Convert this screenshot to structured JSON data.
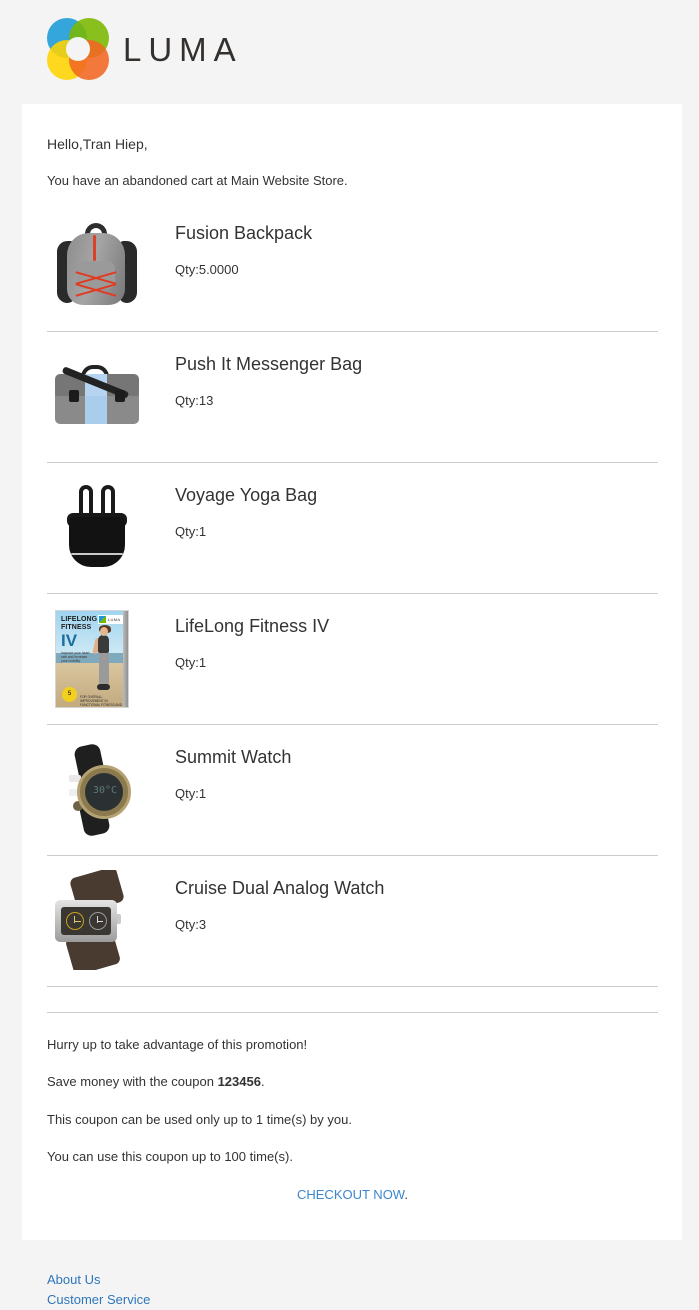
{
  "brand": {
    "name": "LUMA",
    "logo_colors": {
      "blue": "#1a9bd7",
      "green": "#7ab800",
      "yellow": "#ffd400",
      "orange": "#f26722"
    }
  },
  "body": {
    "greeting": "Hello,Tran Hiep,",
    "intro": "You have an abandoned cart at Main Website Store."
  },
  "products": [
    {
      "name": "Fusion Backpack",
      "qty_label": "Qty:5.0000",
      "image": "backpack-image"
    },
    {
      "name": "Push It Messenger Bag",
      "qty_label": "Qty:13",
      "image": "messenger-bag-image"
    },
    {
      "name": "Voyage Yoga Bag",
      "qty_label": "Qty:1",
      "image": "yoga-bag-image"
    },
    {
      "name": "LifeLong Fitness IV",
      "qty_label": "Qty:1",
      "image": "fitness-dvd-image"
    },
    {
      "name": "Summit Watch",
      "qty_label": "Qty:1",
      "image": "summit-watch-image"
    },
    {
      "name": "Cruise Dual Analog Watch",
      "qty_label": "Qty:3",
      "image": "cruise-watch-image"
    }
  ],
  "dvd_art": {
    "title_line1": "LIFELONG",
    "title_line2": "FITNESS",
    "volume": "IV",
    "subtitle": "Improve your heart rate and increase your mobility.",
    "badge": "5",
    "footer": "FOR OVERALL IMPROVEMENT IN FUNCTIONAL FITNESS AND HEALTH",
    "logo_text": "LUMA"
  },
  "summit_watch_art": {
    "display": "30°C"
  },
  "promo": {
    "line1": "Hurry up to take advantage of this promotion!",
    "line2_prefix": "Save money with the coupon ",
    "coupon_code": "123456",
    "line2_suffix": ".",
    "line3": "This coupon can be used only up to 1 time(s) by you.",
    "line4": "You can use this coupon up to 100 time(s).",
    "checkout_label": "CHECKOUT NOW",
    "checkout_suffix": ".",
    "link_color": "#3b86cf"
  },
  "footer": {
    "links": [
      {
        "label": "About Us"
      },
      {
        "label": "Customer Service"
      }
    ],
    "link_color": "#2d76bb"
  }
}
